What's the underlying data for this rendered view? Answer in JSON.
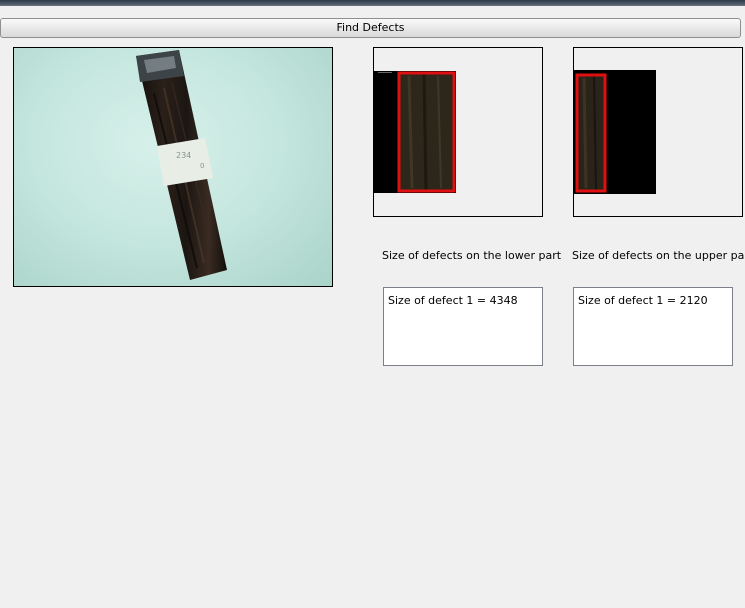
{
  "window": {
    "find_defects_label": "Find Defects"
  },
  "lower_part": {
    "caption": "Size of defects on the lower part",
    "defects": [
      "Size of defect 1 = 4348"
    ]
  },
  "upper_part": {
    "caption": "Size of defects on the upper part",
    "defects": [
      "Size of defect 1 = 2120"
    ]
  },
  "photo": {
    "label_text": "234",
    "label_sub": "0"
  },
  "colors": {
    "background": "#f0f0f0",
    "defect_box": "#e01010",
    "strip": "#1a1410"
  }
}
